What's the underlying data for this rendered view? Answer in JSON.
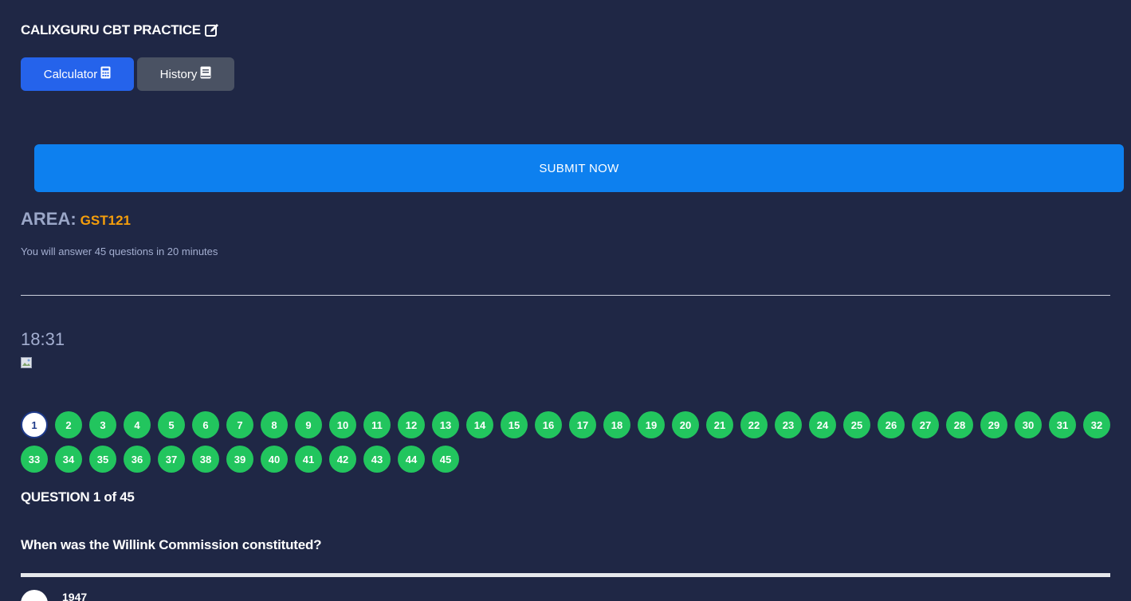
{
  "header": {
    "title": "CALIXGURU CBT PRACTICE"
  },
  "toolbar": {
    "calculator_label": "Calculator",
    "history_label": "History"
  },
  "submit_label": "SUBMIT NOW",
  "area": {
    "label": "AREA:",
    "value": "GST121"
  },
  "info": "You will answer 45 questions in 20 minutes",
  "timer": "18:31",
  "colors": {
    "background": "#1f2745",
    "primary": "#2563eb",
    "submit": "#0d80ef",
    "answered": "#22c55e",
    "area_value": "#f59e0b"
  },
  "question_nav": {
    "rows": [
      [
        "1",
        "2",
        "3",
        "4",
        "5",
        "6",
        "7",
        "8",
        "9",
        "10",
        "11",
        "12",
        "13",
        "14",
        "15",
        "16",
        "17",
        "18",
        "19",
        "20",
        "21",
        "22",
        "23",
        "24",
        "25",
        "26",
        "27",
        "28",
        "29",
        "30",
        "31",
        "32"
      ],
      [
        "33",
        "34",
        "35",
        "36",
        "37",
        "38",
        "39",
        "40",
        "41",
        "42",
        "43",
        "44",
        "45"
      ]
    ],
    "current": "1"
  },
  "question": {
    "counter": "QUESTION 1 of 45",
    "text": "When was the Willink Commission constituted?",
    "first_option": "1947"
  }
}
